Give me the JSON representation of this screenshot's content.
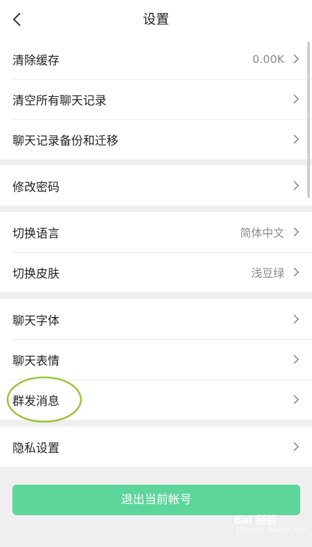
{
  "header": {
    "title": "设置"
  },
  "groups": [
    {
      "items": [
        {
          "label": "清除缓存",
          "value": "0.00K"
        },
        {
          "label": "清空所有聊天记录",
          "value": ""
        },
        {
          "label": "聊天记录备份和迁移",
          "value": ""
        }
      ]
    },
    {
      "items": [
        {
          "label": "修改密码",
          "value": ""
        }
      ]
    },
    {
      "items": [
        {
          "label": "切换语言",
          "value": "简体中文"
        },
        {
          "label": "切换皮肤",
          "value": "浅豆绿"
        }
      ]
    },
    {
      "items": [
        {
          "label": "聊天字体",
          "value": ""
        },
        {
          "label": "聊天表情",
          "value": ""
        },
        {
          "label": "群发消息",
          "value": ""
        }
      ]
    },
    {
      "items": [
        {
          "label": "隐私设置",
          "value": ""
        }
      ]
    }
  ],
  "logout": {
    "label": "退出当前帐号"
  },
  "watermark": {
    "line1": "Bai 经验",
    "line2": "jingyan.baidu.com"
  },
  "colors": {
    "accent": "#5dd69c",
    "highlight": "#9bc43a"
  }
}
